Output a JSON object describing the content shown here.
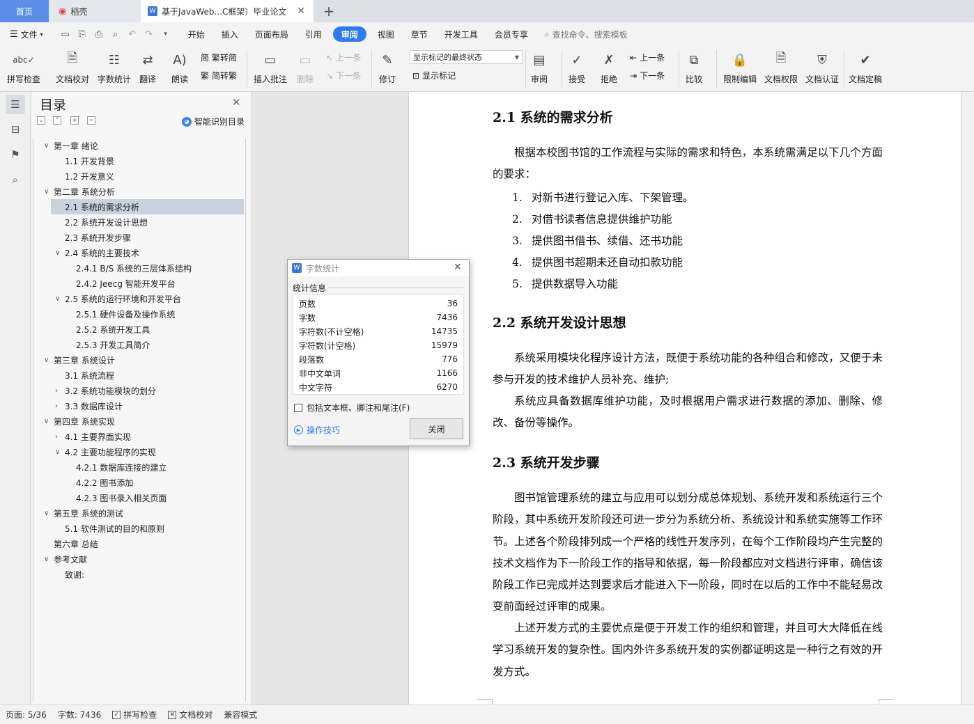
{
  "tabs": {
    "home": "首页",
    "daoke": "稻壳",
    "doc_title": "基于JavaWeb...C框架）毕业论文",
    "new_tab": "+"
  },
  "menu": {
    "file": "文件",
    "items": [
      "开始",
      "插入",
      "页面布局",
      "引用",
      "审阅",
      "视图",
      "章节",
      "开发工具",
      "会员专享"
    ],
    "active": "审阅",
    "search": "查找命令、搜索模板"
  },
  "ribbon": {
    "spell_check": "拼写检查",
    "doc_proofread": "文档校对",
    "word_count": "字数统计",
    "translate": "翻译",
    "read_aloud": "朗读",
    "trad_simp": "繁转简",
    "simp_trad": "简转繁",
    "insert_comment": "插入批注",
    "delete": "删除",
    "prev_comment": "上一条",
    "next_comment": "下一条",
    "revise": "修订",
    "markup_mode": "显示标记的最终状态",
    "show_markup": "显示标记",
    "review": "审阅",
    "accept": "接受",
    "reject": "拒绝",
    "prev_change": "上一条",
    "next_change": "下一条",
    "compare": "比较",
    "restrict_edit": "限制编辑",
    "doc_permission": "文档权限",
    "doc_certify": "文档认证",
    "doc_finalize": "文档定稿"
  },
  "toc": {
    "title": "目录",
    "smart": "智能识别目录",
    "items": [
      {
        "text": "第一章 绪论",
        "arrow": "∨"
      },
      {
        "text": "1.1 开发背景",
        "arrow": ""
      },
      {
        "text": "1.2 开发意义",
        "arrow": ""
      },
      {
        "text": "第二章 系统分析",
        "arrow": "∨"
      },
      {
        "text": "2.1 系统的需求分析",
        "arrow": ""
      },
      {
        "text": "2.2 系统开发设计思想",
        "arrow": ""
      },
      {
        "text": "2.3 系统开发步骤",
        "arrow": ""
      },
      {
        "text": "2.4 系统的主要技术",
        "arrow": "∨"
      },
      {
        "text": "2.4.1 B/S 系统的三层体系结构",
        "arrow": ""
      },
      {
        "text": "2.4.2 Jeecg 智能开发平台",
        "arrow": ""
      },
      {
        "text": "2.5 系统的运行环境和开发平台",
        "arrow": "∨"
      },
      {
        "text": "2.5.1 硬件设备及操作系统",
        "arrow": ""
      },
      {
        "text": "2.5.2 系统开发工具",
        "arrow": ""
      },
      {
        "text": "2.5.3 开发工具简介",
        "arrow": ""
      },
      {
        "text": "第三章 系统设计",
        "arrow": "∨"
      },
      {
        "text": "3.1 系统流程",
        "arrow": ""
      },
      {
        "text": "3.2 系统功能模块的划分",
        "arrow": "›"
      },
      {
        "text": "3.3 数据库设计",
        "arrow": "›"
      },
      {
        "text": "第四章 系统实现",
        "arrow": "∨"
      },
      {
        "text": "4.1 主要界面实现",
        "arrow": "›"
      },
      {
        "text": "4.2 主要功能程序的实现",
        "arrow": "∨"
      },
      {
        "text": "4.2.1 数据库连接的建立",
        "arrow": ""
      },
      {
        "text": "4.2.2 图书添加",
        "arrow": ""
      },
      {
        "text": "4.2.3 图书录入相关页面",
        "arrow": ""
      },
      {
        "text": "第五章 系统的测试",
        "arrow": "∨"
      },
      {
        "text": "5.1 软件测试的目的和原则",
        "arrow": ""
      },
      {
        "text": "第六章 总结",
        "arrow": ""
      },
      {
        "text": "参考文献",
        "arrow": "∨"
      },
      {
        "text": "致谢:",
        "arrow": ""
      }
    ],
    "selected": "2.1 系统的需求分析"
  },
  "document": {
    "h_21": "2.1 系统的需求分析",
    "p_21": "根据本校图书馆的工作流程与实际的需求和特色，本系统需满足以下几个方面的要求：",
    "list": [
      {
        "n": "1.",
        "t": "对新书进行登记入库、下架管理。"
      },
      {
        "n": "2.",
        "t": "对借书读者信息提供维护功能"
      },
      {
        "n": "3.",
        "t": "提供图书借书、续借、还书功能"
      },
      {
        "n": "4.",
        "t": "提供图书超期未还自动扣款功能"
      },
      {
        "n": "5.",
        "t": "提供数据导入功能"
      }
    ],
    "h_22": "2.2 系统开发设计思想",
    "p_22a": "系统采用模块化程序设计方法，既便于系统功能的各种组合和修改，又便于未参与开发的技术维护人员补充、维护;",
    "p_22b": "系统应具备数据库维护功能，及时根据用户需求进行数据的添加、删除、修改、备份等操作。",
    "h_23": "2.3 系统开发步骤",
    "p_23a": "图书馆管理系统的建立与应用可以划分成总体规划、系统开发和系统运行三个阶段，其中系统开发阶段还可进一步分为系统分析、系统设计和系统实施等工作环节。上述各个阶段排列成一个严格的线性开发序列，在每个工作阶段均产生完整的技术文档作为下一阶段工作的指导和依据，每一阶段都应对文档进行评审，确信该阶段工作已完成并达到要求后才能进入下一阶段，同时在以后的工作中不能轻易改变前面经过评审的成果。",
    "p_23b": "上述开发方式的主要优点是便于开发工作的组织和管理，并且可大大降低在线学习系统开发的复杂性。国内外许多系统开发的实例都证明这是一种行之有效的开发方式。"
  },
  "dialog": {
    "title": "字数统计",
    "section": "统计信息",
    "stats": [
      {
        "label": "页数",
        "value": "36"
      },
      {
        "label": "字数",
        "value": "7436"
      },
      {
        "label": "字符数(不计空格)",
        "value": "14735"
      },
      {
        "label": "字符数(计空格)",
        "value": "15979"
      },
      {
        "label": "段落数",
        "value": "776"
      },
      {
        "label": "非中文单词",
        "value": "1166"
      },
      {
        "label": "中文字符",
        "value": "6270"
      }
    ],
    "include_label": "包括文本框、脚注和尾注(F)",
    "tips": "操作技巧",
    "close": "关闭"
  },
  "status": {
    "page": "页面: 5/36",
    "words": "字数: 7436",
    "spell": "拼写检查",
    "proof": "文档校对",
    "compat": "兼容模式"
  },
  "colors": {
    "accent": "#2c7bf0",
    "home_tab": "#5b8ee6",
    "selected_toc": "#c9d2dd"
  }
}
